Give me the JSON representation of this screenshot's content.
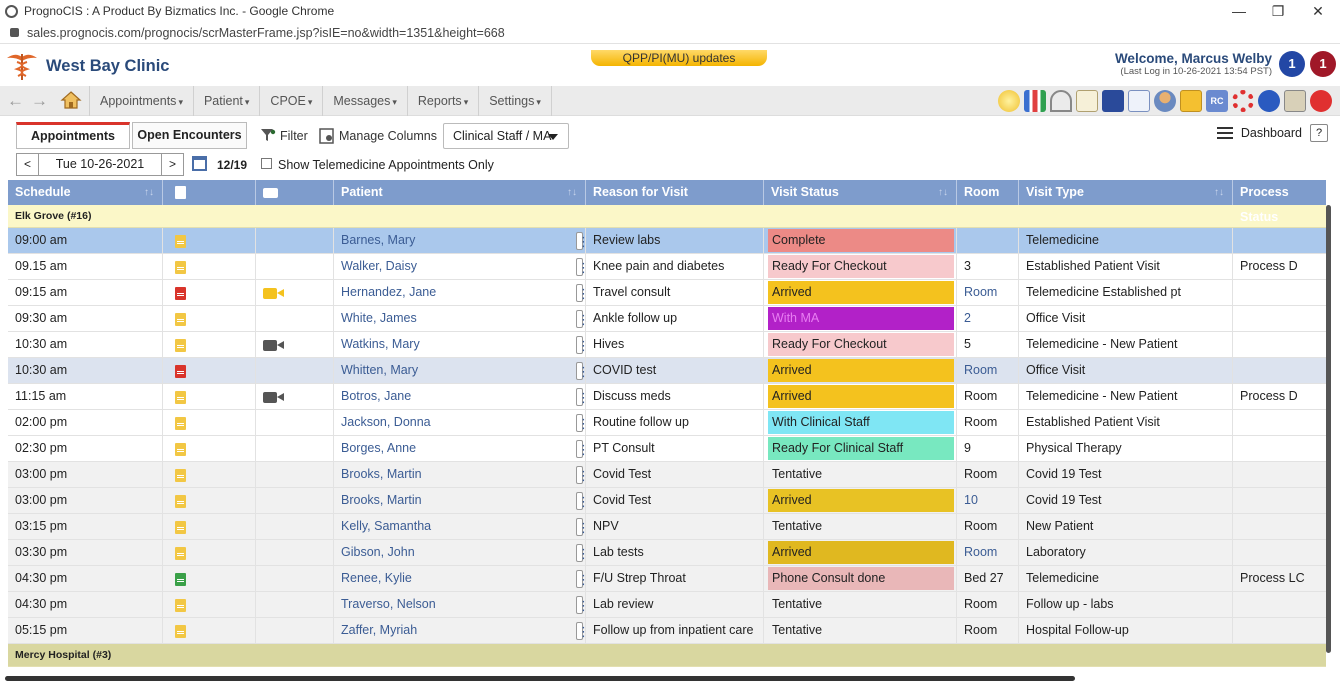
{
  "browser": {
    "title": "PrognoCIS : A Product By Bizmatics Inc. - Google Chrome",
    "url": "sales.prognocis.com/prognocis/scrMasterFrame.jsp?isIE=no&width=1351&height=668",
    "controls": [
      "—",
      "❐",
      "✕"
    ]
  },
  "header": {
    "clinic_name": "West Bay Clinic",
    "updates_label": "QPP/PI(MU) updates",
    "welcome": "Welcome, Marcus Welby",
    "last_log": "(Last Log in 10-26-2021 13:54 PST)",
    "badge_blue": "1",
    "badge_red": "1",
    "colors": {
      "brand": "#2a4a7a",
      "badge_blue": "#2347a5",
      "badge_red": "#a01828"
    }
  },
  "nav": {
    "back_icon": "←",
    "forward_icon": "→",
    "menu": [
      "Appointments",
      "Patient",
      "CPOE",
      "Messages",
      "Reports",
      "Settings"
    ],
    "tools": [
      "new-icon",
      "chart-icon",
      "dashboard-icon",
      "note-icon",
      "bill-icon",
      "schedule-icon",
      "user-icon",
      "alert-icon",
      "rc-icon",
      "help-ring-icon",
      "info-icon",
      "lock-icon",
      "power-icon"
    ]
  },
  "toolbar": {
    "tab_appointments": "Appointments",
    "tab_encounters": "Open Encounters",
    "filter": "Filter",
    "manage_columns": "Manage Columns",
    "staff_select": "Clinical Staff / MA",
    "dashboard": "Dashboard",
    "help": "?"
  },
  "daterow": {
    "prev": "<",
    "next": ">",
    "date": "Tue  10-26-2021",
    "count": "12/19",
    "telemedicine_only": "Show Telemedicine Appointments Only"
  },
  "table": {
    "headers": {
      "schedule": "Schedule",
      "patient": "Patient",
      "reason": "Reason for Visit",
      "status": "Visit Status",
      "room": "Room",
      "type": "Visit Type",
      "process": "Process Status"
    },
    "group1": "Elk Grove (#16)",
    "group2": "Mercy Hospital (#3)",
    "rows": [
      {
        "time": "09:00 am",
        "doc": "#f2c744",
        "cam": "",
        "patient": "Barnes, Mary",
        "reason": "Review labs",
        "status": "Complete",
        "status_bg": "#ec8a86",
        "status_fg": "#222",
        "room": "",
        "room_link": false,
        "type": "Telemedicine",
        "process": "",
        "style": "sel"
      },
      {
        "time": "09.15 am",
        "doc": "#f2c744",
        "cam": "",
        "patient": "Walker, Daisy",
        "reason": "Knee pain and diabetes",
        "status": "Ready For Checkout",
        "status_bg": "#f7c9cc",
        "status_fg": "#222",
        "room": "3",
        "room_link": false,
        "type": "Established Patient Visit",
        "process": "Process D",
        "style": ""
      },
      {
        "time": "09:15 am",
        "doc": "#d9342b",
        "cam": "#f4c21e",
        "patient": "Hernandez, Jane",
        "reason": "Travel consult",
        "status": "Arrived",
        "status_bg": "#f4c21e",
        "status_fg": "#222",
        "room": "Room",
        "room_link": true,
        "type": "Telemedicine Established pt",
        "process": "",
        "style": ""
      },
      {
        "time": "09:30 am",
        "doc": "#f2c744",
        "cam": "",
        "patient": "White, James",
        "reason": "Ankle follow up",
        "status": "With MA",
        "status_bg": "#b221c8",
        "status_fg": "#e87ef2",
        "room": "2",
        "room_link": true,
        "type": "Office Visit",
        "process": "",
        "style": ""
      },
      {
        "time": "10:30 am",
        "doc": "#f2c744",
        "cam": "#555555",
        "patient": "Watkins, Mary",
        "reason": "Hives",
        "status": "Ready For Checkout",
        "status_bg": "#f7c9cc",
        "status_fg": "#222",
        "room": "5",
        "room_link": false,
        "type": "Telemedicine - New Patient",
        "process": "",
        "style": ""
      },
      {
        "time": "10:30 am",
        "doc": "#d9342b",
        "cam": "",
        "patient": "Whitten, Mary",
        "reason": "COVID test",
        "status": "Arrived",
        "status_bg": "#f4c21e",
        "status_fg": "#222",
        "room": "Room",
        "room_link": true,
        "type": "Office Visit",
        "process": "",
        "style": "hov"
      },
      {
        "time": "11:15 am",
        "doc": "#f2c744",
        "cam": "#555555",
        "patient": "Botros, Jane",
        "reason": "Discuss meds",
        "status": "Arrived",
        "status_bg": "#f4c21e",
        "status_fg": "#222",
        "room": "Room",
        "room_link": false,
        "type": "Telemedicine - New Patient",
        "process": "Process D",
        "style": ""
      },
      {
        "time": "02:00 pm",
        "doc": "#f2c744",
        "cam": "",
        "patient": "Jackson, Donna",
        "reason": "Routine follow up",
        "status": "With Clinical Staff",
        "status_bg": "#7fe6f4",
        "status_fg": "#222",
        "room": "Room",
        "room_link": false,
        "type": "Established Patient Visit",
        "process": "",
        "style": ""
      },
      {
        "time": "02:30 pm",
        "doc": "#f2c744",
        "cam": "",
        "patient": "Borges, Anne",
        "reason": "PT Consult",
        "status": "Ready For Clinical Staff",
        "status_bg": "#78e8c0",
        "status_fg": "#222",
        "room": "9",
        "room_link": false,
        "type": "Physical Therapy",
        "process": "",
        "style": ""
      },
      {
        "time": "03:00 pm",
        "doc": "#f2c744",
        "cam": "",
        "patient": "Brooks, Martin",
        "reason": "Covid Test",
        "status": "Tentative",
        "status_bg": "",
        "status_fg": "#222",
        "room": "Room",
        "room_link": false,
        "type": "Covid 19 Test",
        "process": "",
        "style": "alt"
      },
      {
        "time": "03:00 pm",
        "doc": "#f2c744",
        "cam": "",
        "patient": "Brooks, Martin",
        "reason": "Covid Test",
        "status": "Arrived",
        "status_bg": "#e8c224",
        "status_fg": "#222",
        "room": "10",
        "room_link": true,
        "type": "Covid 19 Test",
        "process": "",
        "style": "alt"
      },
      {
        "time": "03:15 pm",
        "doc": "#f2c744",
        "cam": "",
        "patient": "Kelly, Samantha",
        "reason": "NPV",
        "status": "Tentative",
        "status_bg": "",
        "status_fg": "#222",
        "room": "Room",
        "room_link": false,
        "type": "New Patient",
        "process": "",
        "style": "alt"
      },
      {
        "time": "03:30 pm",
        "doc": "#f2c744",
        "cam": "",
        "patient": "Gibson, John",
        "reason": "Lab tests",
        "status": "Arrived",
        "status_bg": "#e0b820",
        "status_fg": "#222",
        "room": "Room",
        "room_link": true,
        "type": "Laboratory",
        "process": "",
        "style": "alt"
      },
      {
        "time": "04:30 pm",
        "doc": "#3aa048",
        "cam": "",
        "patient": "Renee, Kylie",
        "reason": "F/U Strep Throat",
        "status": "Phone Consult done",
        "status_bg": "#e9b7b8",
        "status_fg": "#222",
        "room": "Bed 27",
        "room_link": false,
        "type": "Telemedicine",
        "process": "Process LC",
        "style": "alt"
      },
      {
        "time": "04:30 pm",
        "doc": "#f2c744",
        "cam": "",
        "patient": "Traverso, Nelson",
        "reason": "Lab review",
        "status": "Tentative",
        "status_bg": "",
        "status_fg": "#222",
        "room": "Room",
        "room_link": false,
        "type": "Follow up - labs",
        "process": "",
        "style": "alt"
      },
      {
        "time": "05:15 pm",
        "doc": "#f2c744",
        "cam": "",
        "patient": "Zaffer, Myriah",
        "reason": "Follow up from inpatient care",
        "status": "Tentative",
        "status_bg": "",
        "status_fg": "#222",
        "room": "Room",
        "room_link": false,
        "type": "Hospital Follow-up",
        "process": "",
        "style": "alt"
      }
    ]
  }
}
